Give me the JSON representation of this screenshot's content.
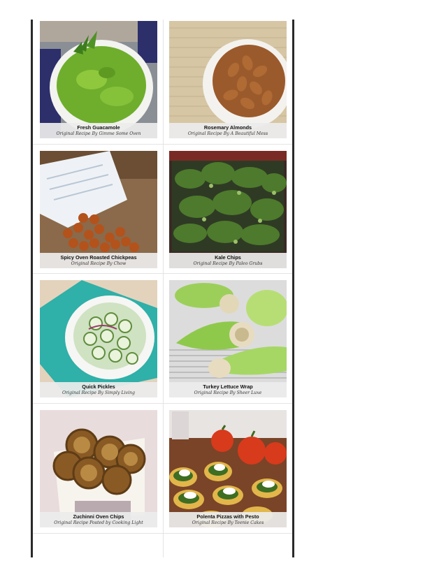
{
  "recipes": [
    {
      "title": "Fresh Guacamole",
      "credit": "Original Recipe By Gimme Some Oven",
      "photo_icon": "guacamole-bowl"
    },
    {
      "title": "Rosemary Almonds",
      "credit": "Original Recipe By A Beautiful Mess",
      "photo_icon": "almond-bowl"
    },
    {
      "title": "Spicy Oven Roasted Chickpeas",
      "credit": "Original Recipe By Chow",
      "photo_icon": "chickpea-cone"
    },
    {
      "title": "Kale Chips",
      "credit": "Original Recipe By Paleo Grubs",
      "photo_icon": "kale-tray"
    },
    {
      "title": "Quick Pickles",
      "credit": "Original Recipe By Simply Living",
      "photo_icon": "pickle-bowl"
    },
    {
      "title": "Turkey Lettuce Wrap",
      "credit": "Original Recipe By Sheer Luxe",
      "photo_icon": "lettuce-wraps"
    },
    {
      "title": "Zuchinni Oven Chips",
      "credit": "Original Recipe Posted by Cooking Light",
      "photo_icon": "zucchini-chips"
    },
    {
      "title": "Polenta Pizzas with Pesto",
      "credit": "Original Recipe By Teenie Cakes",
      "photo_icon": "polenta-pizzas"
    }
  ]
}
